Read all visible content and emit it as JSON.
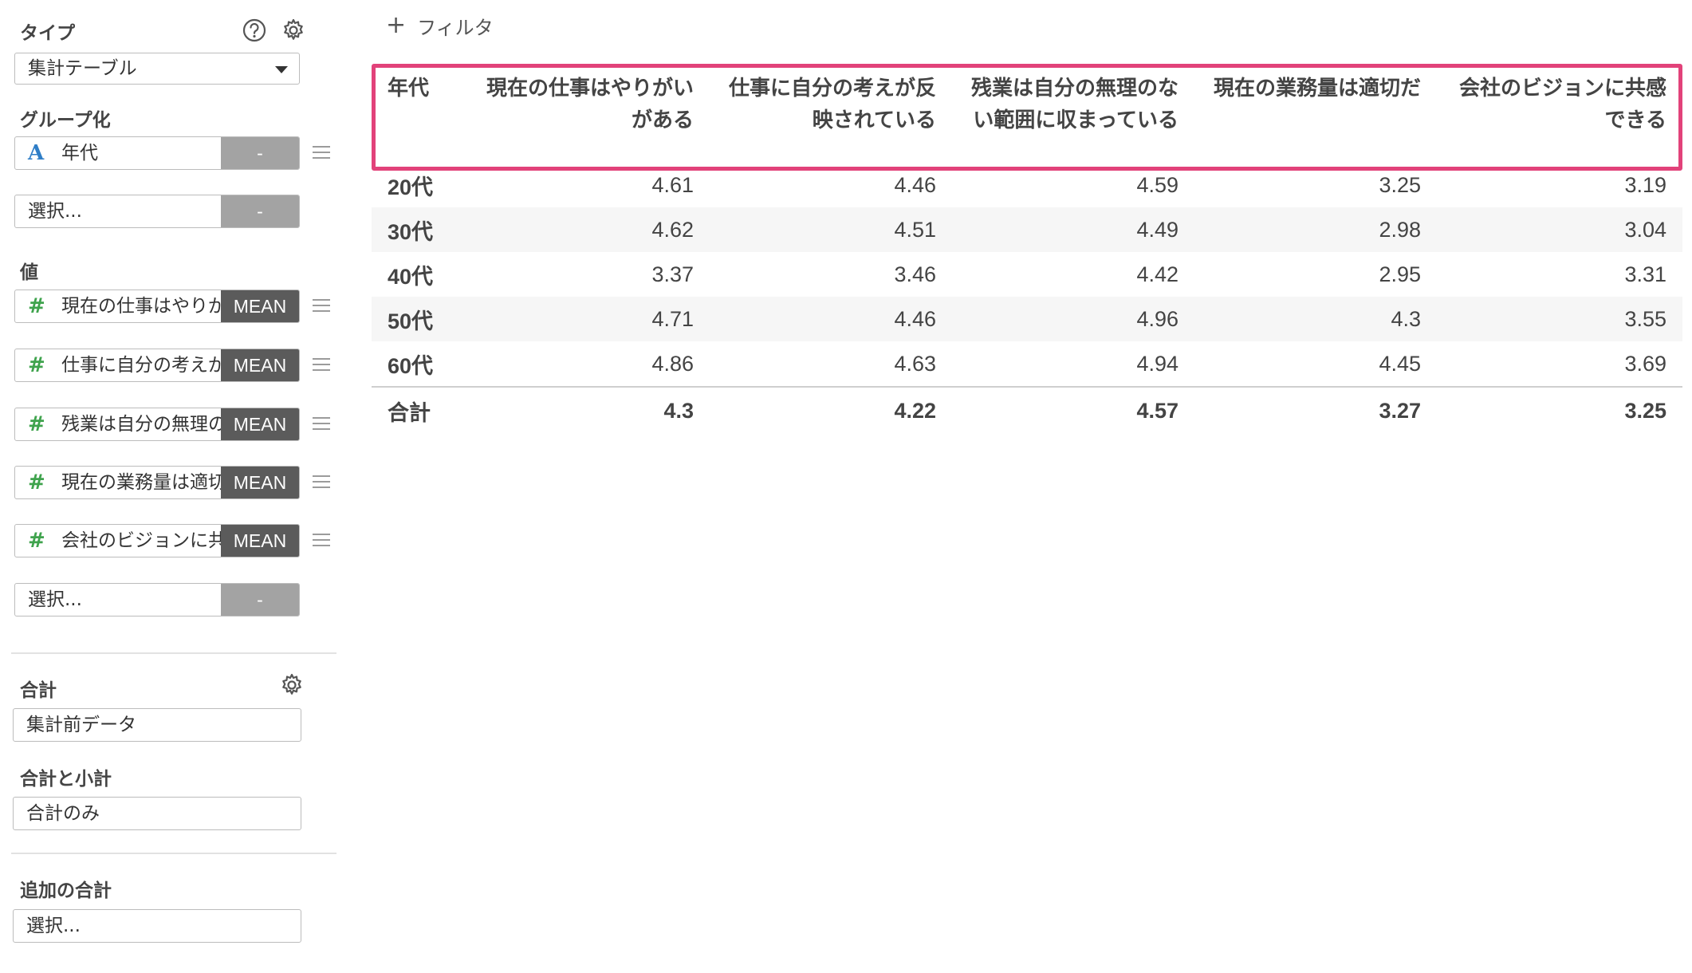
{
  "sidebar": {
    "type": {
      "title": "タイプ",
      "value": "集計テーブル"
    },
    "group": {
      "title": "グループ化",
      "items": [
        {
          "icon": "A",
          "label": "年代",
          "agg": "-"
        }
      ],
      "select": {
        "label": "選択...",
        "agg": "-"
      }
    },
    "values": {
      "title": "値",
      "items": [
        {
          "icon": "#",
          "label": "現在の仕事はやりがいがある",
          "agg": "MEAN"
        },
        {
          "icon": "#",
          "label": "仕事に自分の考えが反映されている",
          "agg": "MEAN"
        },
        {
          "icon": "#",
          "label": "残業は自分の無理のない範囲に収まっている",
          "agg": "MEAN"
        },
        {
          "icon": "#",
          "label": "現在の業務量は適切だ",
          "agg": "MEAN"
        },
        {
          "icon": "#",
          "label": "会社のビジョンに共感できる",
          "agg": "MEAN"
        }
      ],
      "select": {
        "label": "選択...",
        "agg": "-"
      }
    },
    "total": {
      "title": "合計",
      "value": "集計前データ"
    },
    "subtotal": {
      "title": "合計と小計",
      "value": "合計のみ"
    },
    "extra": {
      "title": "追加の合計",
      "value": "選択..."
    }
  },
  "filter": {
    "label": "フィルタ"
  },
  "table": {
    "headers": [
      "年代",
      "現在の仕事はやりがいがある",
      "仕事に自分の考えが反映されている",
      "残業は自分の無理のない範囲に収まっている",
      "現在の業務量は適切だ",
      "会社のビジョンに共感できる"
    ],
    "rows": [
      [
        "20代",
        "4.61",
        "4.46",
        "4.59",
        "3.25",
        "3.19"
      ],
      [
        "30代",
        "4.62",
        "4.51",
        "4.49",
        "2.98",
        "3.04"
      ],
      [
        "40代",
        "3.37",
        "3.46",
        "4.42",
        "2.95",
        "3.31"
      ],
      [
        "50代",
        "4.71",
        "4.46",
        "4.96",
        "4.3",
        "3.55"
      ],
      [
        "60代",
        "4.86",
        "4.63",
        "4.94",
        "4.45",
        "3.69"
      ]
    ],
    "total": [
      "合計",
      "4.3",
      "4.22",
      "4.57",
      "3.27",
      "3.25"
    ]
  },
  "colors": {
    "highlight": "#e2427a",
    "hash_icon": "#3fa34d",
    "alpha_icon": "#2f7ec7",
    "agg_bg": "#5b5b5b",
    "agg_empty_bg": "#a3a3a3"
  }
}
